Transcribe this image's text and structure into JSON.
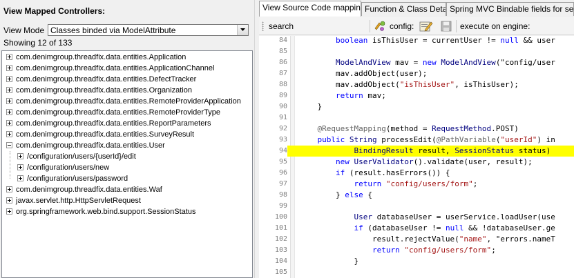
{
  "left": {
    "title": "View Mapped Controllers:",
    "view_mode_label": "View Mode",
    "view_mode_value": "Classes binded via ModelAttribute",
    "showing": "Showing 12 of 133",
    "tree": [
      {
        "label": "com.denimgroup.threadfix.data.entities.Application",
        "level": 0,
        "expanded": false
      },
      {
        "label": "com.denimgroup.threadfix.data.entities.ApplicationChannel",
        "level": 0,
        "expanded": false
      },
      {
        "label": "com.denimgroup.threadfix.data.entities.DefectTracker",
        "level": 0,
        "expanded": false
      },
      {
        "label": "com.denimgroup.threadfix.data.entities.Organization",
        "level": 0,
        "expanded": false
      },
      {
        "label": "com.denimgroup.threadfix.data.entities.RemoteProviderApplication",
        "level": 0,
        "expanded": false
      },
      {
        "label": "com.denimgroup.threadfix.data.entities.RemoteProviderType",
        "level": 0,
        "expanded": false
      },
      {
        "label": "com.denimgroup.threadfix.data.entities.ReportParameters",
        "level": 0,
        "expanded": false
      },
      {
        "label": "com.denimgroup.threadfix.data.entities.SurveyResult",
        "level": 0,
        "expanded": false
      },
      {
        "label": "com.denimgroup.threadfix.data.entities.User",
        "level": 0,
        "expanded": true
      },
      {
        "label": "/configuration/users/{userId}/edit",
        "level": 1,
        "expanded": false
      },
      {
        "label": "/configuration/users/new",
        "level": 1,
        "expanded": false
      },
      {
        "label": "/configuration/users/password",
        "level": 1,
        "expanded": false
      },
      {
        "label": "com.denimgroup.threadfix.data.entities.Waf",
        "level": 0,
        "expanded": false
      },
      {
        "label": "javax.servlet.http.HttpServletRequest",
        "level": 0,
        "expanded": false
      },
      {
        "label": "org.springframework.web.bind.support.SessionStatus",
        "level": 0,
        "expanded": false
      }
    ]
  },
  "right": {
    "tabs": [
      {
        "label": "View Source Code mappings",
        "active": true
      },
      {
        "label": "Function & Class Details",
        "active": false
      },
      {
        "label": "Spring MVC Bindable fields for selecte",
        "active": false
      }
    ],
    "toolbar": {
      "search_label": "search",
      "search_value": "",
      "config_label": "config:",
      "engine_label": "execute on engine:"
    },
    "highlight_color": "#ffff00",
    "code": [
      {
        "n": "84",
        "t": "        boolean isThisUser = currentUser != null && user"
      },
      {
        "n": "85",
        "t": ""
      },
      {
        "n": "86",
        "t": "        ModelAndView mav = new ModelAndView(\"config/user"
      },
      {
        "n": "87",
        "t": "        mav.addObject(user);"
      },
      {
        "n": "88",
        "t": "        mav.addObject(\"isThisUser\", isThisUser);"
      },
      {
        "n": "89",
        "t": "        return mav;"
      },
      {
        "n": "90",
        "t": "    }"
      },
      {
        "n": "91",
        "t": ""
      },
      {
        "n": "92",
        "t": "    @RequestMapping(method = RequestMethod.POST)"
      },
      {
        "n": "93",
        "t": "    public String processEdit(@PathVariable(\"userId\") in"
      },
      {
        "n": "94",
        "t": "            BindingResult result, SessionStatus status)",
        "hl": true
      },
      {
        "n": "95",
        "t": "        new UserValidator().validate(user, result);"
      },
      {
        "n": "96",
        "t": "        if (result.hasErrors()) {"
      },
      {
        "n": "97",
        "t": "            return \"config/users/form\";"
      },
      {
        "n": "98",
        "t": "        } else {"
      },
      {
        "n": "99",
        "t": ""
      },
      {
        "n": "100",
        "t": "            User databaseUser = userService.loadUser(use"
      },
      {
        "n": "101",
        "t": "            if (databaseUser != null && !databaseUser.ge"
      },
      {
        "n": "102",
        "t": "                result.rejectValue(\"name\", \"errors.nameT"
      },
      {
        "n": "103",
        "t": "                return \"config/users/form\";"
      },
      {
        "n": "104",
        "t": "            }"
      },
      {
        "n": "105",
        "t": ""
      }
    ]
  }
}
